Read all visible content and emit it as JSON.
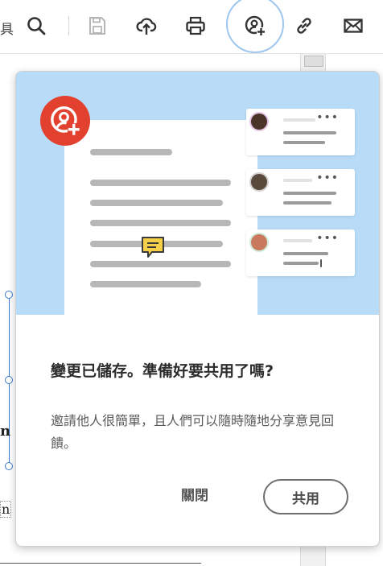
{
  "toolbar": {
    "cut_label": "具",
    "icons": [
      "search-icon",
      "save-icon",
      "upload-icon",
      "print-icon",
      "invite-people-icon",
      "link-icon",
      "email-icon"
    ]
  },
  "popup": {
    "title": "變更已儲存。準備好要共用了嗎?",
    "body": "邀請他人很簡單，且人們可以隨時隨地分享意見回饋。",
    "close_label": "關閉",
    "share_label": "共用"
  },
  "document": {
    "fragment_1": "n",
    "fragment_2": "n"
  },
  "colors": {
    "illustration_bg": "#b8dcf8",
    "badge_red": "#e3412f",
    "ring_blue": "#9ec6ef",
    "selection_blue": "#3b7ad6"
  }
}
